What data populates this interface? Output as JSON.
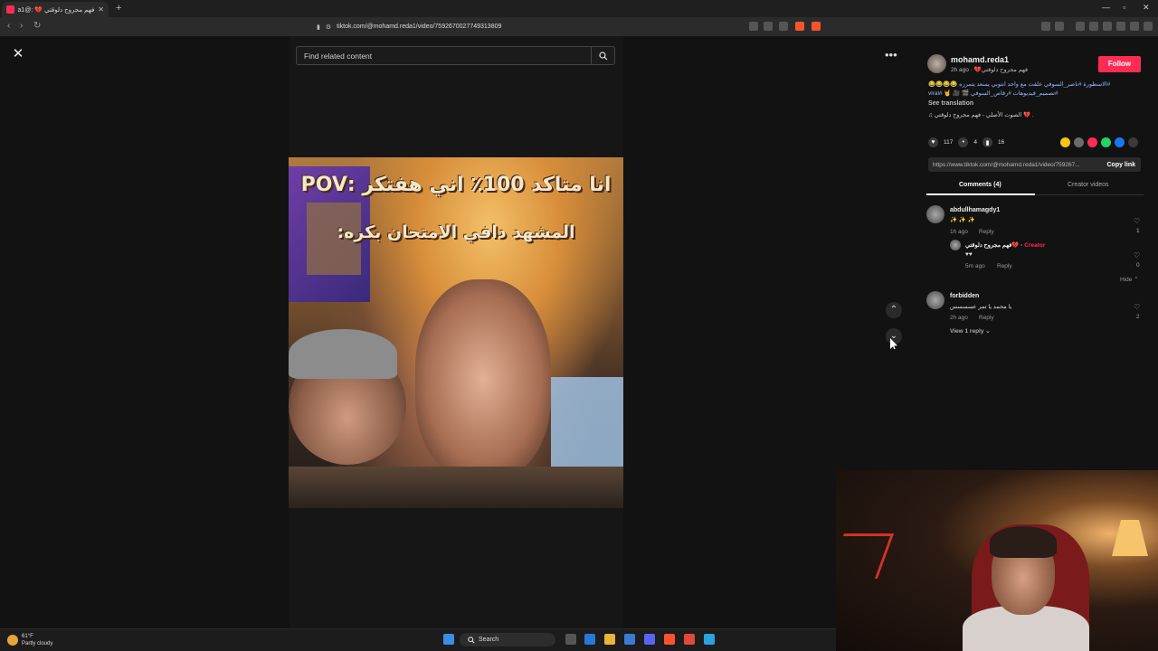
{
  "browser": {
    "tab_title": "فهم مجروح دلوقتي 💔 :@1a1",
    "url": "tiktok.com/@mohamd.reda1/video/7592670027749313809"
  },
  "search": {
    "placeholder": "Find related content"
  },
  "video": {
    "caption_line1": "انا متاكد 100٪ اني هفتكر :POV",
    "caption_line2": "المشهد دافي الامتحان بكره:"
  },
  "author": {
    "name": "mohamd.reda1",
    "subtitle": "فهم مجروح دلوقتي💔 · 2h ago",
    "follow_label": "Follow",
    "description": "#الاسطورة #ناصر_السوفي علقت مع واحد انتوبي يسعد يتمرزه 😂😂😂😂 #تصميم_فيديوهات #رقاص_السوفي 🎬 🎥 🤘 #viral",
    "see_translation": "See translation",
    "music": "♫ الصوت الأصلي - فهم مجروح دلوقتي 💔 ."
  },
  "actions": {
    "likes": "117",
    "comments": "4",
    "saves": "16"
  },
  "share_colors": [
    "#f5c518",
    "#6b6b6b",
    "#fe2c55",
    "#25d366",
    "#1877f2",
    "#3a3a3a"
  ],
  "link": {
    "url": "https://www.tiktok.com/@mohamd.reda1/video/759267...",
    "copy_label": "Copy link"
  },
  "tabs": {
    "comments": "Comments (4)",
    "creator_videos": "Creator videos"
  },
  "comments": [
    {
      "user": "abdullhamagdy1",
      "text": "✨ ✨ ✨",
      "time": "1h ago",
      "reply": "Reply",
      "likes": "1"
    },
    {
      "user": "فهم مجروح دلوقتي💔 ·",
      "creator": "Creator",
      "text": "♥♥",
      "time": "5m ago",
      "reply": "Reply",
      "likes": "0",
      "hide": "Hide ⌃"
    },
    {
      "user": "forbidden",
      "text": "يا محمد يا تمر عسسسس",
      "time": "2h ago",
      "reply": "Reply",
      "likes": "2",
      "view_reply": "View 1 reply ⌄"
    }
  ],
  "taskbar": {
    "temp": "61°F",
    "weather": "Partly cloudy",
    "search": "Search"
  }
}
